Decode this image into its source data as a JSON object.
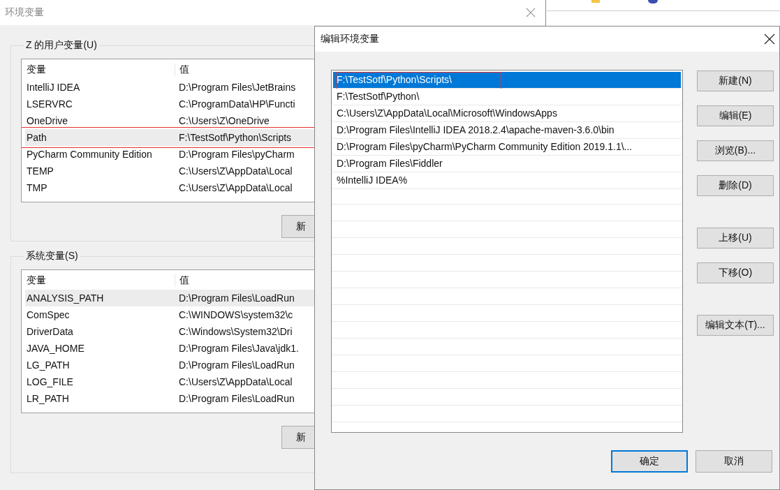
{
  "background_window": {
    "title": "环境变量",
    "user_variables": {
      "label": "Z 的用户变量(U)",
      "columns": [
        "变量",
        "值"
      ],
      "rows": [
        {
          "name": "IntelliJ IDEA",
          "value": "D:\\Program Files\\JetBrains",
          "selected": false,
          "annotated": false
        },
        {
          "name": "LSERVRC",
          "value": "C:\\ProgramData\\HP\\Functi",
          "selected": false,
          "annotated": false
        },
        {
          "name": "OneDrive",
          "value": "C:\\Users\\Z\\OneDrive",
          "selected": false,
          "annotated": false
        },
        {
          "name": "Path",
          "value": "F:\\TestSotf\\Python\\Scripts",
          "selected": true,
          "annotated": true
        },
        {
          "name": "PyCharm Community Edition",
          "value": "D:\\Program Files\\pyCharm",
          "selected": false,
          "annotated": false
        },
        {
          "name": "TEMP",
          "value": "C:\\Users\\Z\\AppData\\Local",
          "selected": false,
          "annotated": false
        },
        {
          "name": "TMP",
          "value": "C:\\Users\\Z\\AppData\\Local",
          "selected": false,
          "annotated": false
        }
      ],
      "button": "新"
    },
    "system_variables": {
      "label": "系统变量(S)",
      "columns": [
        "变量",
        "值"
      ],
      "rows": [
        {
          "name": "ANALYSIS_PATH",
          "value": "D:\\Program Files\\LoadRun",
          "selected": true,
          "annotated": false
        },
        {
          "name": "ComSpec",
          "value": "C:\\WINDOWS\\system32\\c",
          "selected": false,
          "annotated": false
        },
        {
          "name": "DriverData",
          "value": "C:\\Windows\\System32\\Dri",
          "selected": false,
          "annotated": false
        },
        {
          "name": "JAVA_HOME",
          "value": "D:\\Program Files\\Java\\jdk1.",
          "selected": false,
          "annotated": false
        },
        {
          "name": "LG_PATH",
          "value": "D:\\Program Files\\LoadRun",
          "selected": false,
          "annotated": false
        },
        {
          "name": "LOG_FILE",
          "value": "C:\\Users\\Z\\AppData\\Local",
          "selected": false,
          "annotated": false
        },
        {
          "name": "LR_PATH",
          "value": "D:\\Program Files\\LoadRun",
          "selected": false,
          "annotated": false
        }
      ],
      "button": "新"
    }
  },
  "dialog": {
    "title": "编辑环境变量",
    "paths": [
      {
        "text": "F:\\TestSotf\\Python\\Scripts\\",
        "selected": true,
        "annotated": true
      },
      {
        "text": "F:\\TestSotf\\Python\\",
        "selected": false,
        "annotated": false
      },
      {
        "text": "C:\\Users\\Z\\AppData\\Local\\Microsoft\\WindowsApps",
        "selected": false,
        "annotated": false
      },
      {
        "text": "D:\\Program Files\\IntelliJ IDEA 2018.2.4\\apache-maven-3.6.0\\bin",
        "selected": false,
        "annotated": false
      },
      {
        "text": "D:\\Program Files\\pyCharm\\PyCharm Community Edition 2019.1.1\\...",
        "selected": false,
        "annotated": false
      },
      {
        "text": "D:\\Program Files\\Fiddler",
        "selected": false,
        "annotated": false
      },
      {
        "text": "%IntelliJ IDEA%",
        "selected": false,
        "annotated": false
      }
    ],
    "side_button_groups": [
      [
        "新建(N)",
        "编辑(E)",
        "浏览(B)...",
        "删除(D)"
      ],
      [
        "上移(U)",
        "下移(O)"
      ],
      [
        "编辑文本(T)..."
      ]
    ],
    "footer_buttons": [
      {
        "label": "确定",
        "default": true
      },
      {
        "label": "取消",
        "default": false
      }
    ]
  }
}
